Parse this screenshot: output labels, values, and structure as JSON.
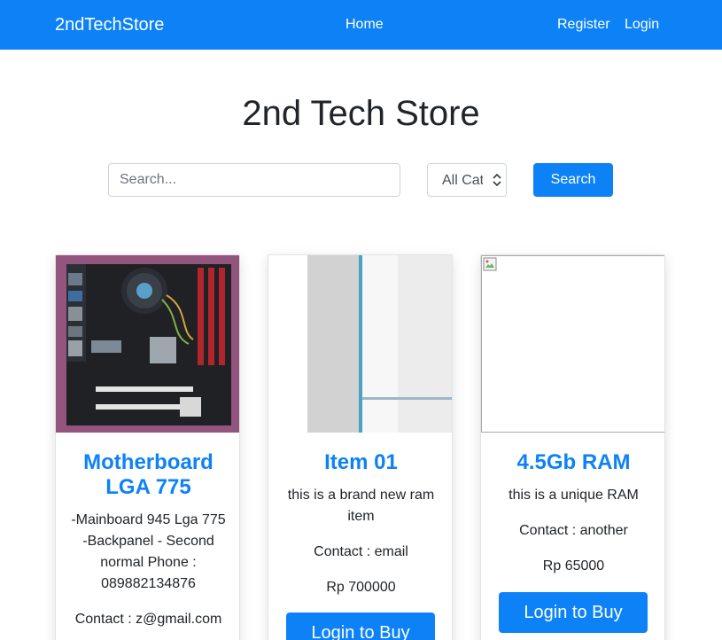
{
  "navbar": {
    "brand": "2ndTechStore",
    "home": "Home",
    "register": "Register",
    "login": "Login"
  },
  "page": {
    "title": "2nd Tech Store"
  },
  "search": {
    "placeholder": "Search...",
    "category_selected": "All Categories",
    "button": "Search"
  },
  "products": [
    {
      "title": "Motherboard LGA 775",
      "description": "-Mainboard 945 Lga 775 -Backpanel - Second normal Phone : 089882134876",
      "contact": "Contact : z@gmail.com",
      "image": "motherboard-photo"
    },
    {
      "title": "Item 01",
      "description": "this is a brand new ram item",
      "contact": "Contact : email",
      "price": "Rp 700000",
      "buy_label": "Login to Buy",
      "image": "ram-photo"
    },
    {
      "title": "4.5Gb RAM",
      "description": "this is a unique RAM",
      "contact": "Contact : another",
      "price": "Rp 65000",
      "buy_label": "Login to Buy",
      "image": "broken-image-icon"
    }
  ],
  "colors": {
    "primary": "#0d82f7",
    "text": "#212529",
    "white": "#ffffff"
  }
}
